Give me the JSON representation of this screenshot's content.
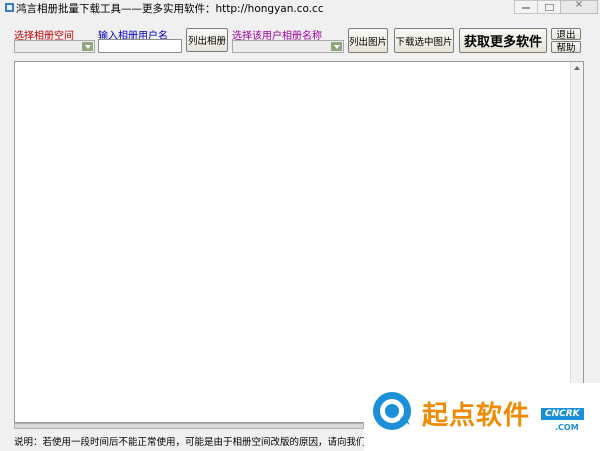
{
  "window": {
    "title": "鸿言相册批量下载工具——更多实用软件：http://hongyan.co.cc"
  },
  "labels": {
    "select_space": "选择相册空间",
    "input_username": "输入相册用户名",
    "select_album": "选择该用户相册名称"
  },
  "inputs": {
    "username_value": ""
  },
  "buttons": {
    "list_albums": "列出相册",
    "list_images": "列出图片",
    "download_selected": "下载选中图片",
    "get_more_software": "获取更多软件",
    "exit": "退出",
    "help": "帮助"
  },
  "status": {
    "text": "说明：若使用一段时间后不能正常使用，可能是由于相册空间改版的原因，请向我们反馈，我们会"
  },
  "watermark": {
    "brand": "起点软件",
    "badge": "CNCRK",
    "domain": ".COM"
  },
  "colors": {
    "label_red": "#c00000",
    "label_blue": "#0000c0",
    "label_purple": "#a000a0",
    "watermark_orange": "#f08a00",
    "watermark_blue": "#1b8fd8"
  },
  "icons": {
    "app": "app-icon",
    "dropdown": "chevron-down-icon",
    "scroll_up": "arrow-up-icon",
    "logo": "cncrk-logo"
  }
}
